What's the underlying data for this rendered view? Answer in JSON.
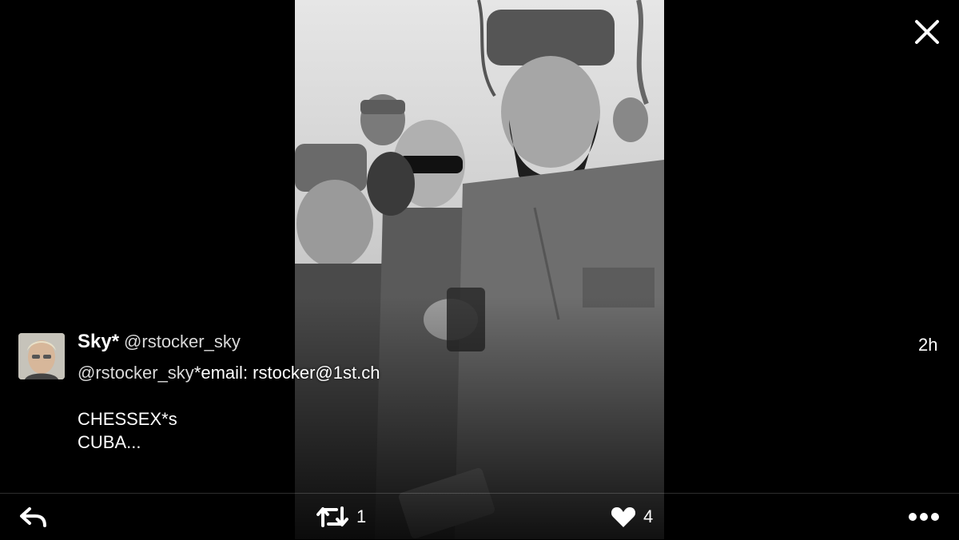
{
  "tweet": {
    "display_name": "Sky*",
    "handle": "@rstocker_sky",
    "timestamp": "2h",
    "body_mention": "@rstocker_sky",
    "body_line1_rest": "*email: rstocker@1st.ch",
    "body_line2": "CHESSEX*s",
    "body_line3": "CUBA..."
  },
  "actions": {
    "retweet_count": "1",
    "like_count": "4"
  },
  "icons": {
    "close": "close-icon",
    "reply": "reply-icon",
    "retweet": "retweet-icon",
    "like": "heart-icon",
    "more": "more-icon"
  },
  "colors": {
    "background": "#000000",
    "text": "#ffffff",
    "secondary_text": "#d9d9d9"
  }
}
